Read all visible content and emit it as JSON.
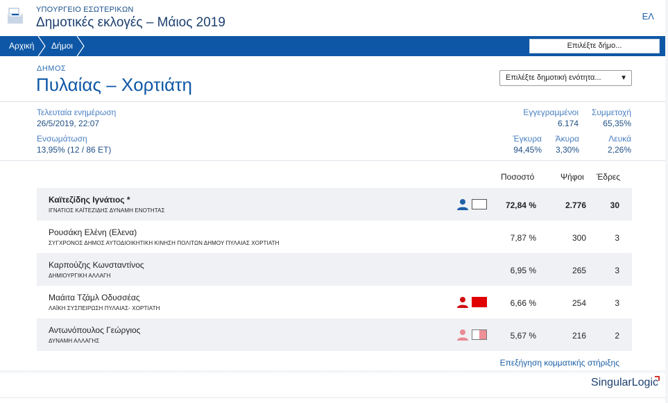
{
  "header": {
    "ministry": "ΥΠΟΥΡΓΕΙΟ ΕΣΩΤΕΡΙΚΩΝ",
    "title": "Δημοτικές εκλογές – Μάιος 2019",
    "lang": "ΕΛ"
  },
  "nav": {
    "home": "Αρχική",
    "municipalities": "Δήμοι",
    "select_municipality": "Επιλέξτε δήμο..."
  },
  "municipality": {
    "label": "ΔΗΜΟΣ",
    "name": "Πυλαίας – Χορτιάτη",
    "unit_select": "Επιλέξτε δημοτική ενότητα..."
  },
  "stats": {
    "last_update_label": "Τελευταία ενημέρωση",
    "last_update_value": "26/5/2019, 22:07",
    "integration_label": "Ενσωμάτωση",
    "integration_value": "13,95% (12 / 86 ΕΤ)",
    "registered_label": "Εγγεγραμμένοι",
    "registered_value": "6.174",
    "turnout_label": "Συμμετοχή",
    "turnout_value": "65,35%",
    "valid_label": "Έγκυρα",
    "valid_value": "94,45%",
    "invalid_label": "Άκυρα",
    "invalid_value": "3,30%",
    "blank_label": "Λευκά",
    "blank_value": "2,26%"
  },
  "table": {
    "headers": {
      "percent": "Ποσοστό",
      "votes": "Ψήφοι",
      "seats": "Έδρες"
    },
    "rows": [
      {
        "candidate": "Καϊτεζίδης Ιγνάτιος *",
        "party": "ΙΓΝΑΤΙΟΣ ΚΑΪΤΕΖΙΔΗΣ ΔΥΝΑΜΗ ΕΝΟΤΗΤΑΣ",
        "percent": "72,84 %",
        "votes": "2.776",
        "seats": "30",
        "person_color": "#1f5fa8",
        "flag": "white"
      },
      {
        "candidate": "Ρουσάκη Ελένη (Ελενα)",
        "party": "ΣΥΓΧΡΟΝΟΣ ΔΗΜΟΣ ΑΥΤΟΔΙΟΙΚΗΤΙΚΗ ΚΙΝΗΣΗ ΠΟΛΙΤΩΝ ΔΗΜΟΥ ΠΥΛΑΙΑΣ ΧΟΡΤΙΑΤΗ",
        "percent": "7,87 %",
        "votes": "300",
        "seats": "3"
      },
      {
        "candidate": "Καρπούζης Κωνσταντίνος",
        "party": "ΔΗΜΙΟΥΡΓΙΚΗ ΑΛΛΑΓΗ",
        "percent": "6,95 %",
        "votes": "265",
        "seats": "3"
      },
      {
        "candidate": "Μαάιτα Τζάμλ Οδυσσέας",
        "party": "ΛΑΪΚΗ ΣΥΣΠΕΙΡΩΣΗ ΠΥΛΑΙΑΣ- ΧΟΡΤΙΑΤΗ",
        "percent": "6,66 %",
        "votes": "254",
        "seats": "3",
        "person_color": "#d01010",
        "flag": "red"
      },
      {
        "candidate": "Αντωνόπουλος Γεώργιος",
        "party": "ΔΥΝΑΜΗ ΑΛΛΑΓΗΣ",
        "percent": "5,67 %",
        "votes": "216",
        "seats": "2",
        "person_color": "#e88a94",
        "flag": "pink"
      }
    ]
  },
  "support_link": "Επεξήγηση κομματικής στήριξης",
  "brand": {
    "singular": "Singular",
    "logic": "Logic"
  },
  "colors": {
    "accent": "#0e57a6",
    "row_shade": "#eff1f4"
  }
}
